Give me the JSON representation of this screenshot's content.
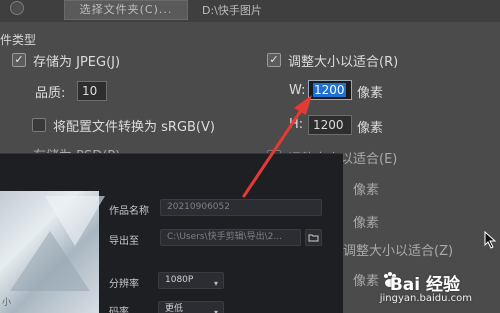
{
  "top": {
    "choose_folder_label": "选择文件夹(C)...",
    "path": "D:\\快手图片"
  },
  "section_title": "件类型",
  "jpeg": {
    "label": "存储为 JPEG(J)",
    "quality_label": "品质:",
    "quality_value": "10",
    "convert_label": "将配置文件转换为 sRGB(V)",
    "resize_label": "调整大小以适合(R)",
    "w_label": "W:",
    "w_value": "1200",
    "h_label": "H:",
    "h_value": "1200",
    "unit_px": "像素"
  },
  "psd": {
    "label": "存储为 PSD(P)",
    "resize_label": "调整大小以适合(E)",
    "unit_px": "像素"
  },
  "other": {
    "resize_label": "调整大小以适合(Z)",
    "unit_px": "像素"
  },
  "dialog": {
    "title_label": "作品名称",
    "title_value": "20210906052",
    "export_label": "导出至",
    "export_value": "C:\\Users\\快手剪辑\\导出\\2...",
    "resolution_label": "分辨率",
    "resolution_value": "1080P",
    "bitrate_label": "码率",
    "bitrate_value": "更低",
    "preview_caption": "小"
  },
  "watermark": {
    "logo": "Bai  经验",
    "url": "jingyan.baidu.com"
  },
  "colors": {
    "highlight": "#1e6fd6",
    "arrow": "#e53935"
  }
}
